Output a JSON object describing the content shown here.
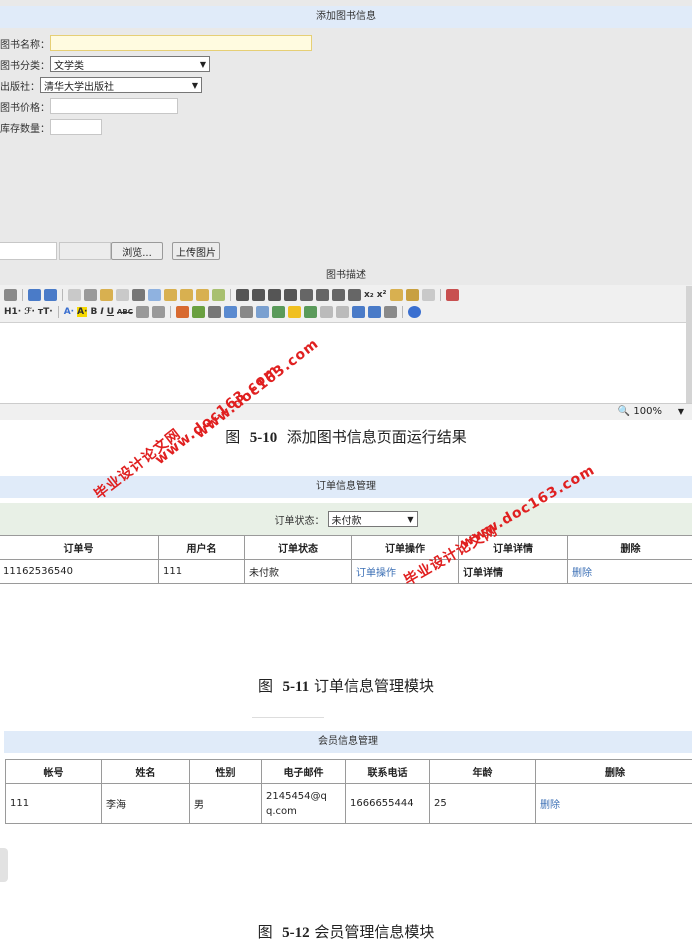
{
  "fig1": {
    "title": "添加图书信息",
    "fields": {
      "name_label": "图书名称：",
      "category_label": "图书分类：",
      "category_value": "文学类",
      "publisher_label": "出版社：",
      "publisher_value": "清华大学出版社",
      "price_label": "图书价格：",
      "stock_label": "库存数量："
    },
    "browse_label": "浏览...",
    "upload_label": "上传图片",
    "desc_label": "图书描述",
    "toolbar_text": {
      "h1": "H1·",
      "font": "ℱ·",
      "size": "тT·",
      "fore": "A·",
      "back": "A·",
      "bold": "B",
      "italic": "I",
      "underline": "U",
      "abc": "ABC",
      "sub": "x₂",
      "sup": "x²"
    },
    "zoom": "100%",
    "caption_prefix": "图",
    "caption_num": "5-10",
    "caption_text": "添加图书信息页面运行结果"
  },
  "fig2": {
    "title": "订单信息管理",
    "filter_label": "订单状态：",
    "filter_value": "未付款",
    "headers": [
      "订单号",
      "用户名",
      "订单状态",
      "订单操作",
      "订单详情",
      "删除"
    ],
    "row": {
      "order_no": "11162536540",
      "user": "111",
      "status": "未付款",
      "op": "订单操作",
      "detail": "订单详情",
      "delete": "删除"
    },
    "caption_prefix": "图",
    "caption_num": "5-11",
    "caption_text": "订单信息管理模块"
  },
  "fig3": {
    "title": "会员信息管理",
    "headers": [
      "帐号",
      "姓名",
      "性别",
      "电子邮件",
      "联系电话",
      "年龄",
      "删除"
    ],
    "row": {
      "account": "111",
      "name": "李海",
      "gender": "男",
      "email_l1": "2145454@q",
      "email_l2": "q.com",
      "phone": "1666655444",
      "age": "25",
      "delete": "删除"
    },
    "caption_prefix": "图",
    "caption_num": "5-12",
    "caption_text": "会员管理信息模块"
  },
  "watermarks": {
    "site_a": "毕业设计论文网",
    "url_a": "www.doc163.com",
    "url_b": "www.doc163.com",
    "site_b": "毕业设计论文网",
    "url_c": "www.doc163.com"
  },
  "colors": {
    "title_bar": "#e0ebf9",
    "link": "#3b6fb5",
    "watermark": "#e02020"
  }
}
